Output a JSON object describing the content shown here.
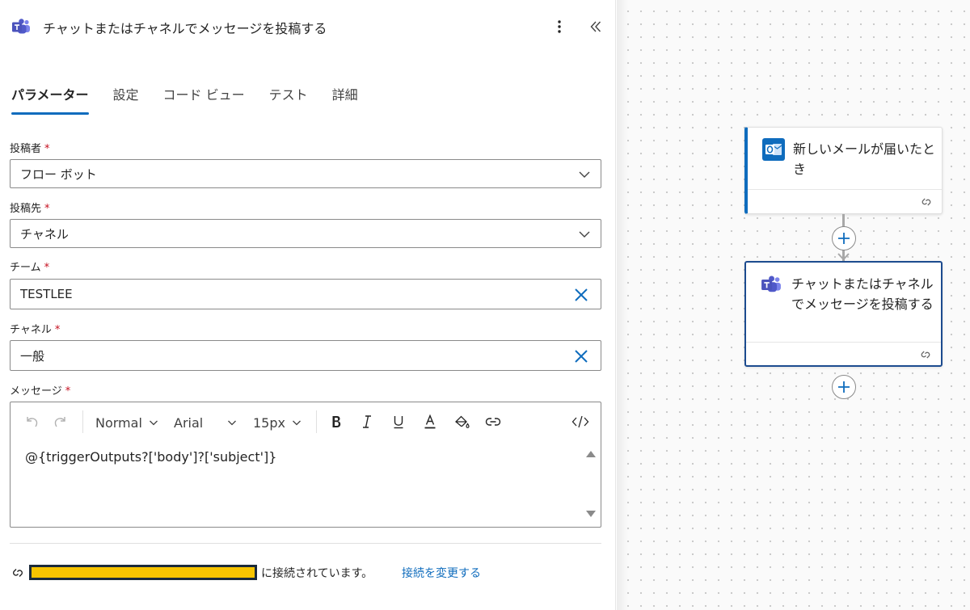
{
  "panel": {
    "title": "チャットまたはチャネルでメッセージを投稿する",
    "icons": {
      "app": "teams-icon",
      "more": "more-vertical-icon",
      "collapse": "double-chevron-left-icon"
    }
  },
  "tabs": [
    {
      "label": "パラメーター",
      "active": true
    },
    {
      "label": "設定",
      "active": false
    },
    {
      "label": "コード ビュー",
      "active": false
    },
    {
      "label": "テスト",
      "active": false
    },
    {
      "label": "詳細",
      "active": false
    }
  ],
  "fields": {
    "post_as": {
      "label": "投稿者",
      "required": "*",
      "value": "フロー ボット"
    },
    "post_in": {
      "label": "投稿先",
      "required": "*",
      "value": "チャネル"
    },
    "team": {
      "label": "チーム",
      "required": "*",
      "value": "TESTLEE"
    },
    "channel": {
      "label": "チャネル",
      "required": "*",
      "value": "一般"
    },
    "message": {
      "label": "メッセージ",
      "required": "*",
      "value": "@{triggerOutputs?['body']?['subject']}"
    }
  },
  "editor_toolbar": {
    "format": "Normal",
    "font": "Arial",
    "size": "15px",
    "buttons": [
      "undo-icon",
      "redo-icon",
      "bold-icon",
      "italic-icon",
      "underline-icon",
      "font-color-icon",
      "highlight-icon",
      "link-icon",
      "code-view-icon"
    ]
  },
  "connection": {
    "status_text": "に接続されています。",
    "change_link": "接続を変更する"
  },
  "flow": {
    "trigger": {
      "title": "新しいメールが届いたとき",
      "icon": "outlook-icon"
    },
    "action": {
      "title": "チャットまたはチャネルでメッセージを投稿する",
      "icon": "teams-icon"
    }
  },
  "colors": {
    "accent": "#0f6cbd",
    "required": "#c50f1f",
    "selected_card_border": "#1c4b8f",
    "redaction": "#f7c400"
  }
}
